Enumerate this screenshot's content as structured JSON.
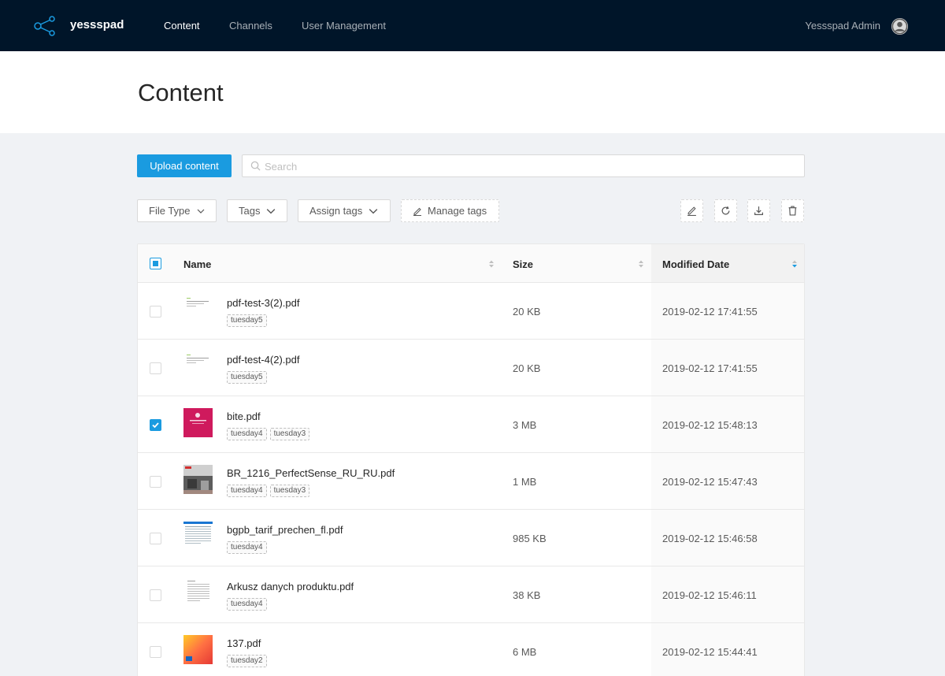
{
  "app": {
    "brand": "yessspad"
  },
  "nav": {
    "items": [
      {
        "label": "Content"
      },
      {
        "label": "Channels"
      },
      {
        "label": "User Management"
      }
    ],
    "user_name": "Yessspad Admin"
  },
  "page": {
    "title": "Content"
  },
  "toolbar": {
    "upload_label": "Upload content",
    "search_placeholder": "Search",
    "search_value": "",
    "filters": {
      "file_type": "File Type",
      "tags": "Tags",
      "assign_tags": "Assign tags",
      "manage_tags": "Manage tags"
    },
    "icons": [
      "edit-icon",
      "refresh-icon",
      "download-icon",
      "delete-icon"
    ]
  },
  "table": {
    "columns": {
      "name": "Name",
      "size": "Size",
      "modified": "Modified Date"
    },
    "sort": {
      "column": "Modified Date",
      "direction": "descending"
    },
    "rows": [
      {
        "name": "pdf-test-3(2).pdf",
        "tags": [
          "tuesday5"
        ],
        "size": "20 KB",
        "modified": "2019-02-12 17:41:55",
        "checked": false,
        "thumb": "text"
      },
      {
        "name": "pdf-test-4(2).pdf",
        "tags": [
          "tuesday5"
        ],
        "size": "20 KB",
        "modified": "2019-02-12 17:41:55",
        "checked": false,
        "thumb": "text"
      },
      {
        "name": "bite.pdf",
        "tags": [
          "tuesday4",
          "tuesday3"
        ],
        "size": "3 MB",
        "modified": "2019-02-12 15:48:13",
        "checked": true,
        "thumb": "pink"
      },
      {
        "name": "BR_1216_PerfectSense_RU_RU.pdf",
        "tags": [
          "tuesday4",
          "tuesday3"
        ],
        "size": "1 MB",
        "modified": "2019-02-12 15:47:43",
        "checked": false,
        "thumb": "photo"
      },
      {
        "name": "bgpb_tarif_prechen_fl.pdf",
        "tags": [
          "tuesday4"
        ],
        "size": "985 KB",
        "modified": "2019-02-12 15:46:58",
        "checked": false,
        "thumb": "doc"
      },
      {
        "name": "Arkusz danych produktu.pdf",
        "tags": [
          "tuesday4"
        ],
        "size": "38 KB",
        "modified": "2019-02-12 15:46:11",
        "checked": false,
        "thumb": "sheet"
      },
      {
        "name": "137.pdf",
        "tags": [
          "tuesday2"
        ],
        "size": "6 MB",
        "modified": "2019-02-12 15:44:41",
        "checked": false,
        "thumb": "orange"
      }
    ]
  },
  "colors": {
    "topbar": "#001529",
    "primary": "#1a9be0",
    "brand_pink": "#d81b60"
  }
}
